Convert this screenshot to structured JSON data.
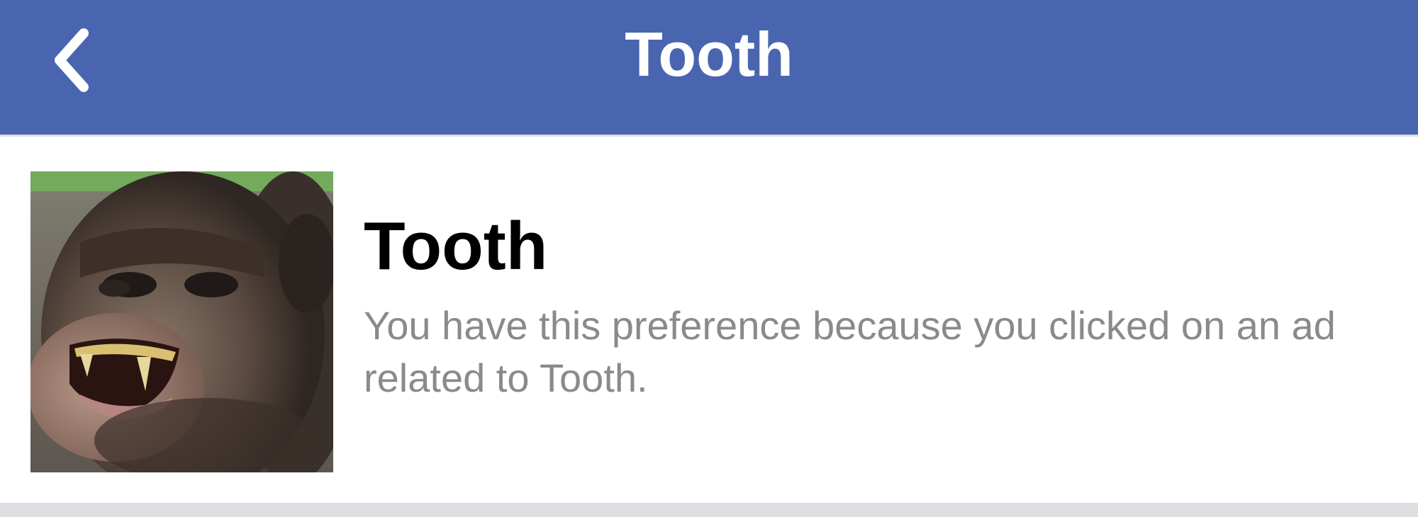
{
  "header": {
    "title": "Tooth",
    "background_color": "#4a65b0",
    "back_icon": "chevron-left-icon"
  },
  "preference": {
    "title": "Tooth",
    "description": "You have this preference because you clicked on an ad related to Tooth.",
    "image_subject": "chimpanzee showing teeth"
  },
  "colors": {
    "title_text": "#000000",
    "description_text": "#8a8a8a",
    "bottom_bar": "#dcdee2"
  }
}
